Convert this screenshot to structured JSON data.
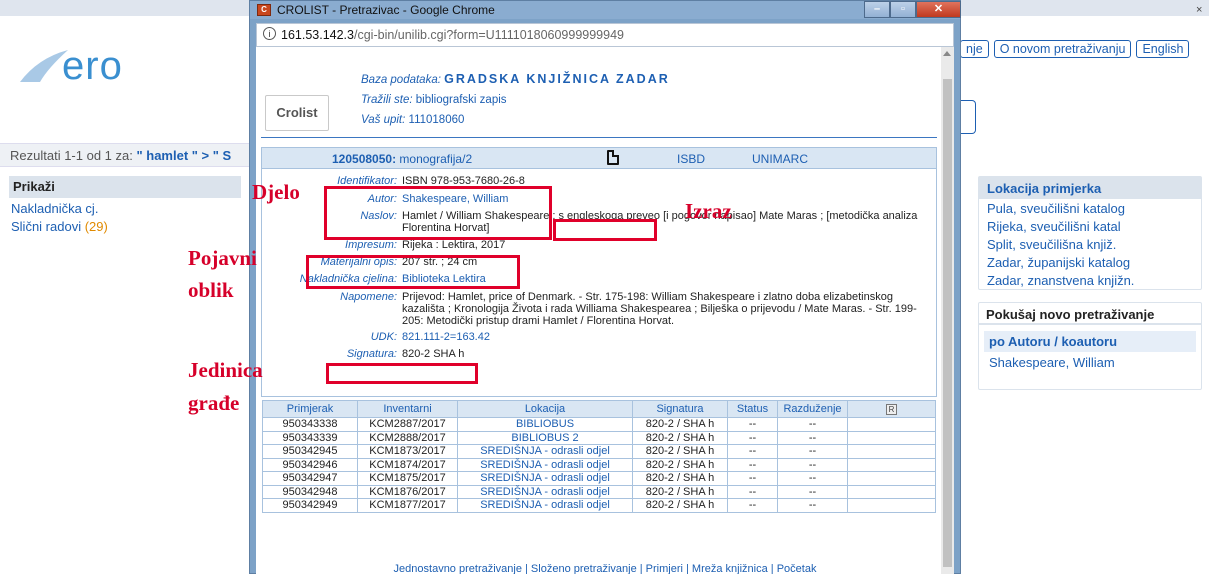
{
  "background": {
    "logo_text": "ero",
    "top_buttons": [
      "nje",
      "O novom pretraživanju",
      "English"
    ],
    "results_prefix": "Rezultati 1-1 od 1 za:",
    "results_query": "\" hamlet \" > \" S",
    "left_panel": {
      "title": "Prikaži",
      "items": [
        {
          "label": "Nakladnička cj.",
          "count": ""
        },
        {
          "label": "Slični radovi",
          "count": "(29)"
        }
      ]
    },
    "right_panel": {
      "location_title": "Lokacija primjerka",
      "locations": [
        "Pula, sveučilišni katalog",
        "Rijeka, sveučilišni katal",
        "Split, sveučilišna knjiž.",
        "Zadar, županijski katalog",
        "Zadar, znanstvena knjižn."
      ],
      "new_search_title": "Pokušaj novo pretraživanje",
      "by_author": "po Autoru / koautoru",
      "author": "Shakespeare, William"
    },
    "close_glyph": "×"
  },
  "window": {
    "title": "CROLIST - Pretrazivac - Google Chrome",
    "icon_text": "C",
    "minimize": "–",
    "maximize": "▫",
    "close": "✕",
    "info_glyph": "i",
    "url_host": "161.53.142.3",
    "url_path": "/cgi-bin/unilib.cgi?form=U1111018060999999949"
  },
  "header": {
    "logo": "Crolist",
    "db_label": "Baza podataka:",
    "db_value": "GRADSKA KNJIŽNICA ZADAR",
    "search_label": "Tražili ste:",
    "search_value": "bibliografski zapis",
    "query_label": "Vaš upit:",
    "query_value": "111018060"
  },
  "record": {
    "id": "120508050:",
    "type": "monografija/2",
    "isbd": "ISBD",
    "unimarc": "UNIMARC",
    "fields": [
      {
        "label": "Identifikator:",
        "value": "ISBN 978-953-7680-26-8"
      },
      {
        "label": "Autor:",
        "value": "Shakespeare, William"
      },
      {
        "label": "Naslov:",
        "value": "Hamlet / William Shakespeare ; s engleskoga preveo [i pogovor napisao] Mate Maras ; [metodička analiza Florentina Horvat]"
      },
      {
        "label": "Impresum:",
        "value": "Rijeka : Lektira, 2017"
      },
      {
        "label": "Materijalni opis:",
        "value": "207 str. ; 24 cm"
      },
      {
        "label": "Nakladnička cjelina:",
        "value": "Biblioteka Lektira"
      },
      {
        "label": "Napomene:",
        "value": "Prijevod: Hamlet, price of Denmark. - Str. 175-198: William Shakespeare i zlatno doba elizabetinskog kazališta ; Kronologija Života i rada Williama Shakespearea ; Bilješka o prijevodu / Mate Maras. - Str. 199-205: Metodički pristup drami Hamlet / Florentina Horvat."
      },
      {
        "label": "UDK:",
        "value": "821.111-2=163.42"
      },
      {
        "label": "Signatura:",
        "value": "820-2 SHA h"
      }
    ]
  },
  "copies": {
    "headers": [
      "Primjerak",
      "Inventarni",
      "Lokacija",
      "Signatura",
      "Status",
      "Razduženje",
      "R"
    ],
    "rows": [
      [
        "950343338",
        "KCM2887/2017",
        "BIBLIOBUS",
        "820-2 / SHA h",
        "--",
        "--"
      ],
      [
        "950343339",
        "KCM2888/2017",
        "BIBLIOBUS 2",
        "820-2 / SHA h",
        "--",
        "--"
      ],
      [
        "950342945",
        "KCM1873/2017",
        "SREDIŠNJA - odrasli odjel",
        "820-2 / SHA h",
        "--",
        "--"
      ],
      [
        "950342946",
        "KCM1874/2017",
        "SREDIŠNJA - odrasli odjel",
        "820-2 / SHA h",
        "--",
        "--"
      ],
      [
        "950342947",
        "KCM1875/2017",
        "SREDIŠNJA - odrasli odjel",
        "820-2 / SHA h",
        "--",
        "--"
      ],
      [
        "950342948",
        "KCM1876/2017",
        "SREDIŠNJA - odrasli odjel",
        "820-2 / SHA h",
        "--",
        "--"
      ],
      [
        "950342949",
        "KCM1877/2017",
        "SREDIŠNJA - odrasli odjel",
        "820-2 / SHA h",
        "--",
        "--"
      ]
    ]
  },
  "footer": "Jednostavno pretraživanje | Složeno pretraživanje | Primjeri | Mreža knjižnica | Početak",
  "annotations": {
    "djelo": "Djelo",
    "izraz": "Izraz",
    "pojavni_1": "Pojavni",
    "pojavni_2": "oblik",
    "jedinica_1": "Jedinica",
    "jedinica_2": "građe"
  },
  "colors": {
    "link": "#1d5fb2",
    "annotation": "#e0002a",
    "panel_header": "#d9e6f3",
    "window_frame": "#7da2c7"
  }
}
